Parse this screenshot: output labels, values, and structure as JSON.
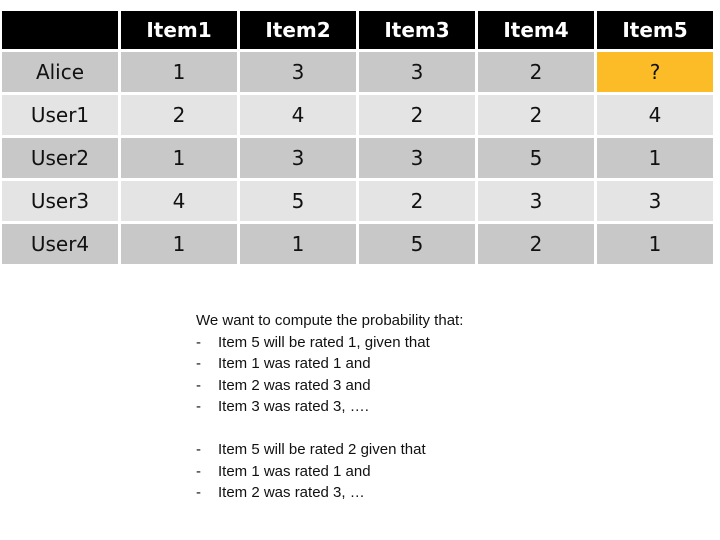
{
  "table": {
    "columns": [
      "",
      "Item1",
      "Item2",
      "Item3",
      "Item4",
      "Item5"
    ],
    "rows": [
      {
        "user": "Alice",
        "ratings": [
          "1",
          "3",
          "3",
          "2",
          "?"
        ]
      },
      {
        "user": "User1",
        "ratings": [
          "2",
          "4",
          "2",
          "2",
          "4"
        ]
      },
      {
        "user": "User2",
        "ratings": [
          "1",
          "3",
          "3",
          "5",
          "1"
        ]
      },
      {
        "user": "User3",
        "ratings": [
          "4",
          "5",
          "2",
          "3",
          "3"
        ]
      },
      {
        "user": "User4",
        "ratings": [
          "1",
          "1",
          "5",
          "2",
          "1"
        ]
      }
    ],
    "highlight_color": "#fbbc28"
  },
  "text": {
    "intro": "We want to compute the probability that:",
    "group1": [
      "Item 5 will be rated 1, given that",
      "Item 1 was rated 1 and",
      "Item 2 was rated 3 and",
      "Item 3 was rated 3, …."
    ],
    "group2": [
      "Item 5 will be rated 2 given that",
      "Item 1 was rated 1 and",
      "Item 2 was rated 3, …"
    ],
    "dash": "-"
  }
}
